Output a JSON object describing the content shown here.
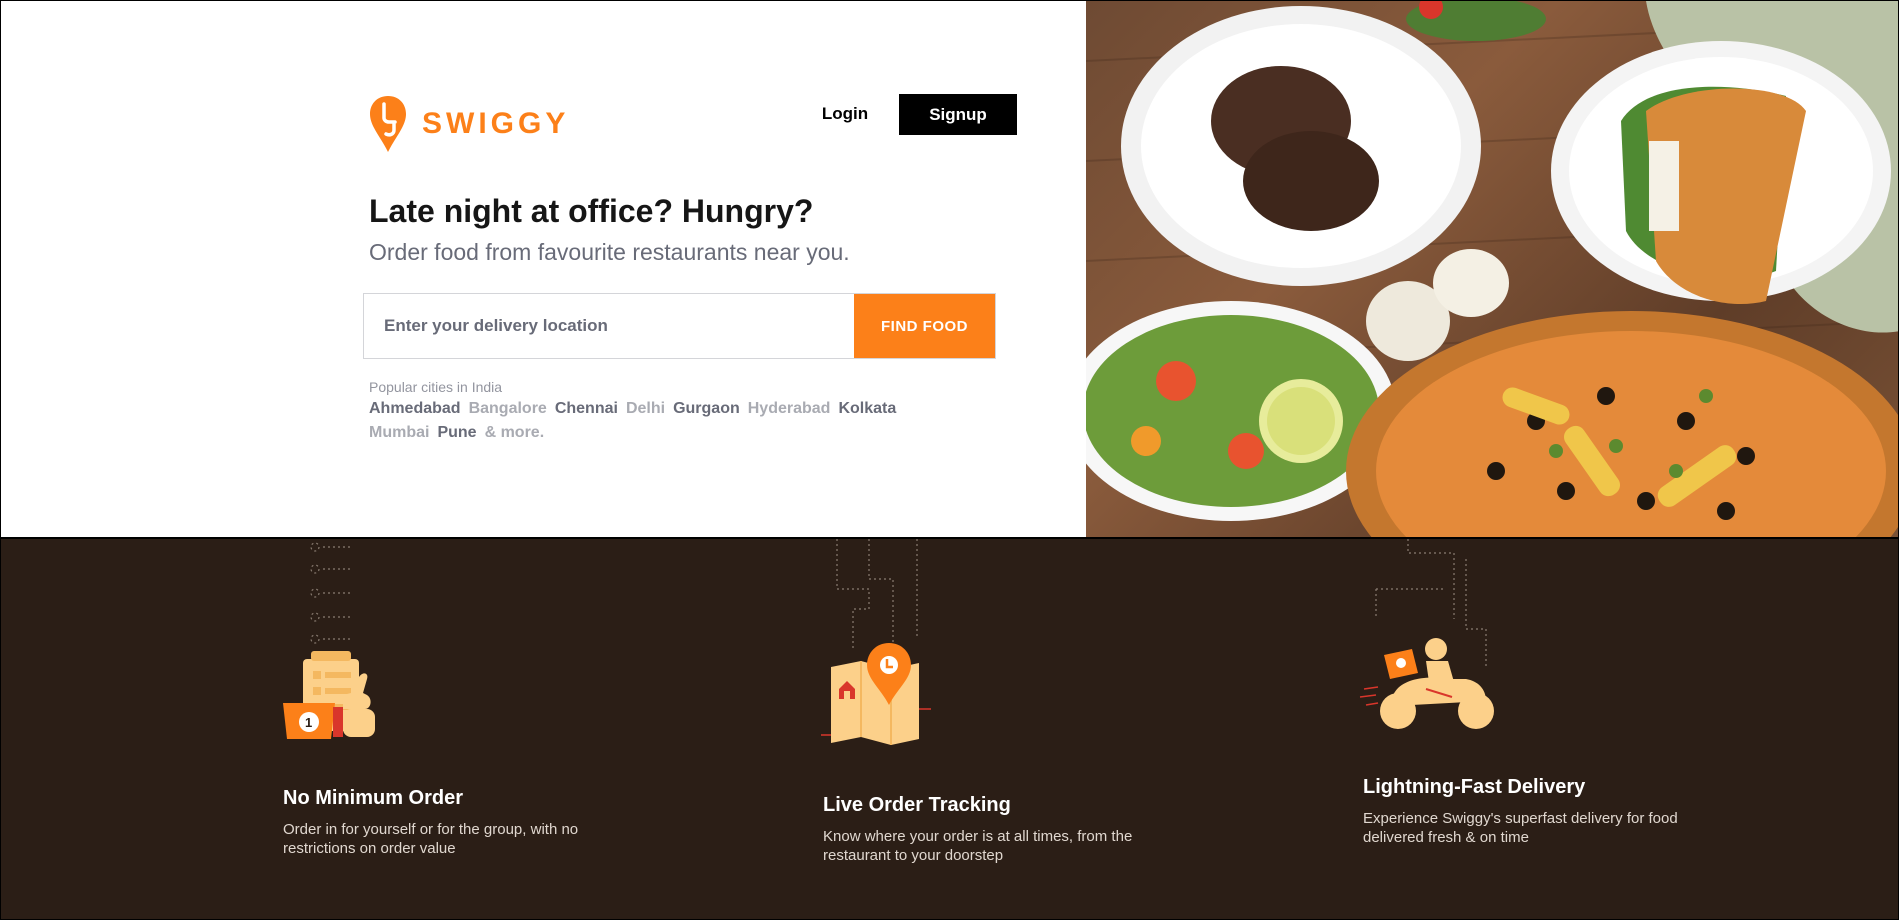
{
  "brand": {
    "name": "SWIGGY",
    "accent": "#fc8019"
  },
  "header": {
    "login_label": "Login",
    "signup_label": "Signup"
  },
  "hero": {
    "headline": "Late night at office? Hungry?",
    "subheadline": "Order food from favourite restaurants near you.",
    "search": {
      "placeholder": "Enter your delivery location",
      "value": ""
    },
    "find_food_label": "FIND FOOD",
    "popular_label": "Popular cities in India",
    "cities": [
      {
        "name": "Ahmedabad",
        "tone": "dark"
      },
      {
        "name": "Bangalore",
        "tone": "light"
      },
      {
        "name": "Chennai",
        "tone": "dark"
      },
      {
        "name": "Delhi",
        "tone": "light"
      },
      {
        "name": "Gurgaon",
        "tone": "dark"
      },
      {
        "name": "Hyderabad",
        "tone": "light"
      },
      {
        "name": "Kolkata",
        "tone": "dark"
      },
      {
        "name": "Mumbai",
        "tone": "light"
      },
      {
        "name": "Pune",
        "tone": "dark"
      },
      {
        "name": "& more.",
        "tone": "light"
      }
    ]
  },
  "features": [
    {
      "icon": "order-checklist-thumbs-up-icon",
      "title": "No Minimum Order",
      "description": "Order in for yourself or for the group, with no restrictions on order value"
    },
    {
      "icon": "map-location-pin-icon",
      "title": "Live Order Tracking",
      "description": "Know where your order is at all times, from the restaurant to your doorstep"
    },
    {
      "icon": "delivery-scooter-icon",
      "title": "Lightning-Fast Delivery",
      "description": "Experience Swiggy's superfast delivery for food delivered fresh & on time"
    }
  ],
  "colors": {
    "features_background": "#2b1e16",
    "illustration_light": "#fcd08a",
    "illustration_orange": "#fc8019"
  }
}
